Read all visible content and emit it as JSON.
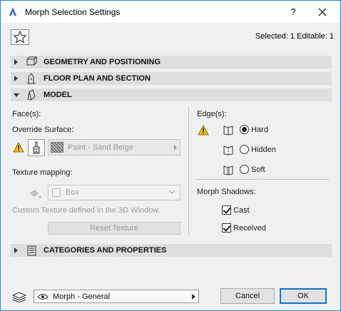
{
  "window": {
    "title": "Morph Selection Settings",
    "help_label": "?",
    "close_icon": "close-icon",
    "accent_color": "#1e8bd6"
  },
  "toolbar": {
    "favorites_icon": "star-icon",
    "selection_info": "Selected: 1 Editable: 1"
  },
  "sections": [
    {
      "label": "GEOMETRY AND POSITIONING",
      "expanded": false,
      "icon": "geometry-icon"
    },
    {
      "label": "FLOOR PLAN AND SECTION",
      "expanded": false,
      "icon": "floor-plan-icon"
    },
    {
      "label": "MODEL",
      "expanded": true,
      "icon": "model-icon"
    },
    {
      "label": "CATEGORIES AND PROPERTIES",
      "expanded": false,
      "icon": "categories-icon"
    }
  ],
  "model": {
    "faces_label": "Face(s):",
    "override_surface_label": "Override Surface:",
    "surface_value": "Paint - Sand Beige",
    "texture_mapping_label": "Texture mapping:",
    "texture_mapping_value": "Box",
    "custom_texture_note": "Custom Texture defined in the 3D Window.",
    "reset_texture_label": "Reset Texture",
    "edges_label": "Edge(s):",
    "edge_options": [
      {
        "label": "Hard",
        "selected": true
      },
      {
        "label": "Hidden",
        "selected": false
      },
      {
        "label": "Soft",
        "selected": false
      }
    ],
    "morph_shadows_label": "Morph Shadows:",
    "shadow_options": [
      {
        "label": "Cast",
        "checked": true
      },
      {
        "label": "Received",
        "checked": true
      }
    ]
  },
  "footer": {
    "profile_value": "Morph - General",
    "cancel_label": "Cancel",
    "ok_label": "OK"
  }
}
